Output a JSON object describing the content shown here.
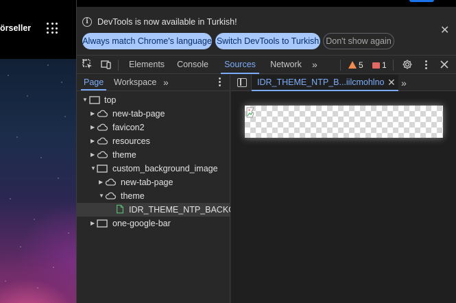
{
  "browser_page": {
    "partial_label": "örseller",
    "apps_icon": "apps-grid-icon"
  },
  "infobar": {
    "message": "DevTools is now available in Turkish!",
    "btn_match_language": "Always match Chrome's language",
    "btn_switch_language": "Switch DevTools to Turkish",
    "btn_dont_show": "Don't show again",
    "close_glyph": "✕"
  },
  "toolbar": {
    "tabs": [
      "Elements",
      "Console",
      "Sources",
      "Network"
    ],
    "active_tab": "Sources",
    "more_glyph": "»",
    "warnings_count": "5",
    "errors_count": "1"
  },
  "navigator": {
    "tabs": [
      "Page",
      "Workspace"
    ],
    "active_tab": "Page",
    "more_glyph": "»",
    "tree": [
      {
        "label": "top",
        "icon": "frame-icon",
        "expanded": true
      },
      {
        "label": "new-tab-page",
        "icon": "cloud-icon",
        "expanded": false
      },
      {
        "label": "favicon2",
        "icon": "cloud-icon",
        "expanded": false
      },
      {
        "label": "resources",
        "icon": "cloud-icon",
        "expanded": false
      },
      {
        "label": "theme",
        "icon": "cloud-icon",
        "expanded": false
      },
      {
        "label": "custom_background_image",
        "icon": "frame-icon",
        "expanded": true
      },
      {
        "label": "new-tab-page",
        "icon": "cloud-icon",
        "expanded": false
      },
      {
        "label": "theme",
        "icon": "cloud-icon",
        "expanded": true
      },
      {
        "label": "IDR_THEME_NTP_BACKGROUND",
        "icon": "file-icon",
        "selected": true
      },
      {
        "label": "one-google-bar",
        "icon": "frame-icon",
        "expanded": false
      }
    ]
  },
  "editor": {
    "file_tab_label": "IDR_THEME_NTP_B...iilcmohlnohnjl",
    "close_glyph": "✕",
    "more_glyph": "»"
  },
  "colors": {
    "accent": "#7cacf8",
    "pill_bg": "#a8c7fa",
    "warning": "#f28b50",
    "error": "#e46962",
    "file_icon": "#5bb974"
  }
}
